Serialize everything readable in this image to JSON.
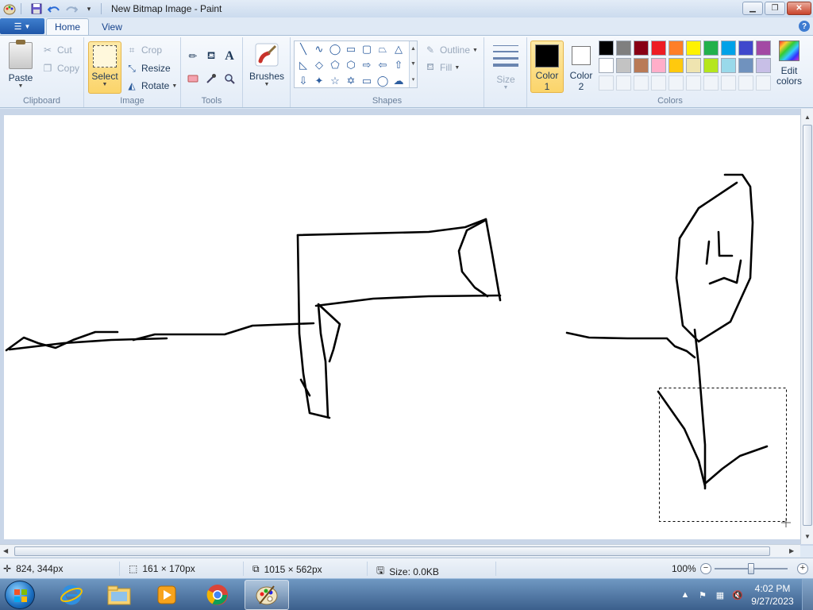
{
  "window": {
    "title": "New Bitmap Image - Paint"
  },
  "tabs": {
    "home": "Home",
    "view": "View"
  },
  "clipboard": {
    "paste": "Paste",
    "cut": "Cut",
    "copy": "Copy",
    "label": "Clipboard"
  },
  "image": {
    "select": "Select",
    "crop": "Crop",
    "resize": "Resize",
    "rotate": "Rotate",
    "label": "Image"
  },
  "tools": {
    "label": "Tools"
  },
  "brushes": {
    "label": "Brushes"
  },
  "shapes": {
    "outline": "Outline",
    "fill": "Fill",
    "label": "Shapes"
  },
  "size": {
    "label": "Size"
  },
  "colors": {
    "color1_line1": "Color",
    "color1_line2": "1",
    "color2_line1": "Color",
    "color2_line2": "2",
    "edit_line1": "Edit",
    "edit_line2": "colors",
    "label": "Colors",
    "color1_value": "#000000",
    "color2_value": "#ffffff",
    "palette_row1": [
      "#000000",
      "#7f7f7f",
      "#880015",
      "#ed1c24",
      "#ff7f27",
      "#fff200",
      "#22b14c",
      "#00a2e8",
      "#3f48cc",
      "#a349a4"
    ],
    "palette_row2": [
      "#ffffff",
      "#c3c3c3",
      "#b97a57",
      "#ffaec9",
      "#ffc90e",
      "#efe4b0",
      "#b5e61d",
      "#99d9ea",
      "#7092be",
      "#c8bfe7"
    ],
    "palette_row3": [
      "#f0f4f9",
      "#f0f4f9",
      "#f0f4f9",
      "#f0f4f9",
      "#f0f4f9",
      "#f0f4f9",
      "#f0f4f9",
      "#f0f4f9",
      "#f0f4f9",
      "#f0f4f9"
    ]
  },
  "status": {
    "cursor_pos": "824, 344px",
    "selection_size": "161 × 170px",
    "canvas_size": "1015 × 562px",
    "file_size": "Size: 0.0KB",
    "zoom": "100%",
    "zoom_level": 0.5
  },
  "taskbar": {
    "time": "4:02 PM",
    "date": "9/27/2023"
  }
}
